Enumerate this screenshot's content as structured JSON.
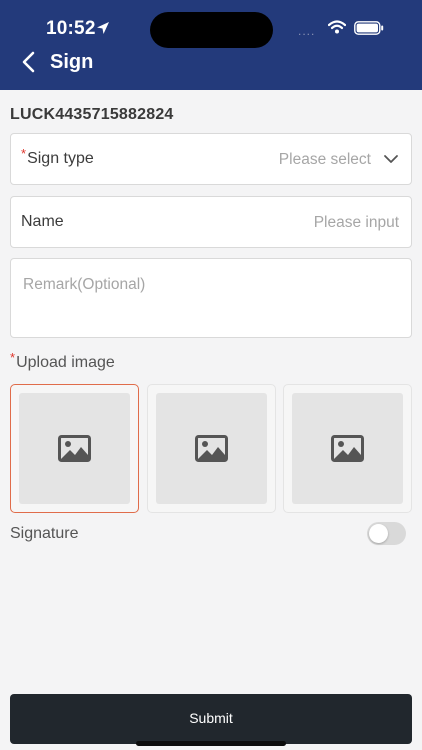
{
  "status_bar": {
    "time": "10:52",
    "signal": "...."
  },
  "header": {
    "title": "Sign"
  },
  "order_number": "LUCK4435715882824",
  "form": {
    "sign_type": {
      "required_mark": "*",
      "label": "Sign type",
      "placeholder": "Please select"
    },
    "name": {
      "label": "Name",
      "placeholder": "Please input"
    },
    "remark": {
      "placeholder": "Remark(Optional)"
    },
    "upload": {
      "required_mark": "*",
      "label": "Upload image",
      "slots": [
        "image-placeholder-icon",
        "image-placeholder-icon",
        "image-placeholder-icon"
      ]
    },
    "signature": {
      "label": "Signature",
      "enabled": false
    }
  },
  "submit_label": "Submit",
  "colors": {
    "header": "#233a7b",
    "required": "#e0352b",
    "submit": "#21272d",
    "active_slot_border": "#e06c4a"
  }
}
